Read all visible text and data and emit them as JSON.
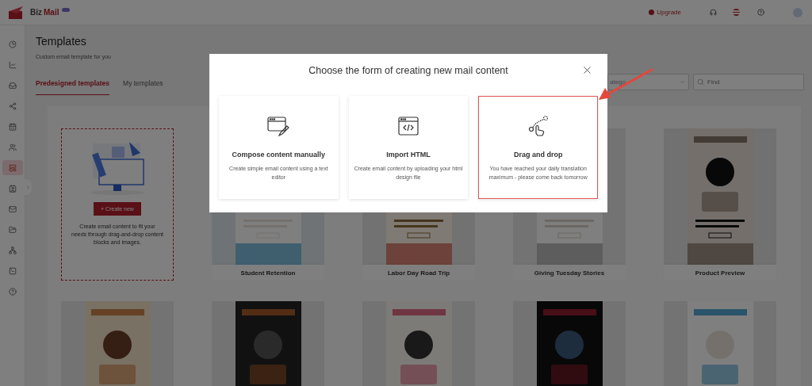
{
  "header": {
    "brand": {
      "first": "Biz",
      "second": "Mail"
    },
    "upgrade": "Upgrade"
  },
  "sidebar": {
    "items": [
      {
        "selected": false
      },
      {
        "selected": false
      },
      {
        "selected": false
      },
      {
        "selected": false
      },
      {
        "selected": false
      },
      {
        "selected": false
      },
      {
        "selected": true
      },
      {
        "selected": false
      },
      {
        "selected": false
      },
      {
        "selected": false
      },
      {
        "selected": false
      },
      {
        "selected": false
      },
      {
        "selected": false
      }
    ]
  },
  "page": {
    "title": "Templates",
    "subtitle": "Custom email template for you"
  },
  "tabs": [
    {
      "label": "Predesigned templates",
      "selected": true
    },
    {
      "label": "My templates",
      "selected": false
    }
  ],
  "category_select": {
    "placeholder": "atego"
  },
  "search": {
    "placeholder": "Find"
  },
  "create_card": {
    "button": "+ Create new",
    "description": "Create email content to fit your needs through drag-and-drop content blocks and images."
  },
  "templates": [
    {
      "title": "Student Retention"
    },
    {
      "title": "Labor Day Road Trip"
    },
    {
      "title": "Giving Tuesday Stories"
    },
    {
      "title": "Product Preview"
    },
    {
      "kind": "picture"
    },
    {
      "kind": "picture"
    },
    {
      "kind": "picture"
    },
    {
      "kind": "picture"
    },
    {
      "kind": "picture"
    }
  ],
  "dialog": {
    "title": "Choose the form of creating new mail content",
    "options": [
      {
        "kind": "compose",
        "title": "Compose content manually",
        "description": "Create simple email content using a text editor",
        "selected": false
      },
      {
        "kind": "html",
        "title": "Import HTML",
        "description": "Create email content by uploading your html design file",
        "selected": false
      },
      {
        "kind": "dragdrop",
        "title": "Drag and drop",
        "description": "You have reached your daily translation maximum - please come back tomorrow",
        "selected": true
      }
    ]
  }
}
